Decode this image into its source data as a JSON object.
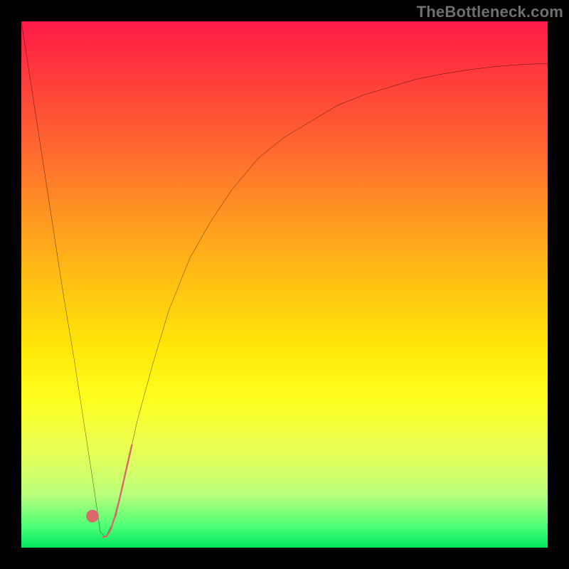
{
  "watermark": "TheBottleneck.com",
  "colors": {
    "frame": "#000000",
    "curve_stroke": "#000000",
    "marker_fill": "#d86a6a",
    "gradient_top": "#ff1a47",
    "gradient_bottom": "#00e85e"
  },
  "chart_data": {
    "type": "line",
    "title": "",
    "xlabel": "",
    "ylabel": "",
    "xlim": [
      0,
      100
    ],
    "ylim": [
      0,
      100
    ],
    "grid": false,
    "legend": false,
    "note": "No axis ticks or numeric labels are visible in the image; x and y values are estimated as percentages of the plotting area, with y=0 at the bottom (green) and y=100 at the top (red). Lower y indicates better (less bottleneck).",
    "series": [
      {
        "name": "bottleneck-curve",
        "stroke": "#000000",
        "x": [
          0,
          2,
          4,
          6,
          8,
          10,
          12,
          14,
          15,
          16,
          18,
          20,
          22,
          25,
          28,
          32,
          36,
          40,
          45,
          50,
          55,
          60,
          65,
          70,
          75,
          80,
          85,
          90,
          95,
          100
        ],
        "y": [
          100,
          87,
          74,
          61,
          48,
          36,
          23,
          10,
          3,
          2,
          6,
          15,
          24,
          35,
          45,
          55,
          62,
          68,
          74,
          78,
          81,
          84,
          86,
          87.5,
          89,
          90,
          90.8,
          91.4,
          91.8,
          92
        ]
      }
    ],
    "markers": [
      {
        "name": "optimum-dot",
        "x": 13.5,
        "y": 6,
        "r": 1.2,
        "fill": "#d86a6a"
      },
      {
        "name": "highlight-segment",
        "stroke": "#d86a6a",
        "width": 2.4,
        "x": [
          15.5,
          16.2,
          17.0,
          17.8,
          18.6,
          19.4,
          20.2,
          21.0
        ],
        "y": [
          2.0,
          2.2,
          3.5,
          6.0,
          9.0,
          12.5,
          16.0,
          19.5
        ]
      }
    ]
  }
}
